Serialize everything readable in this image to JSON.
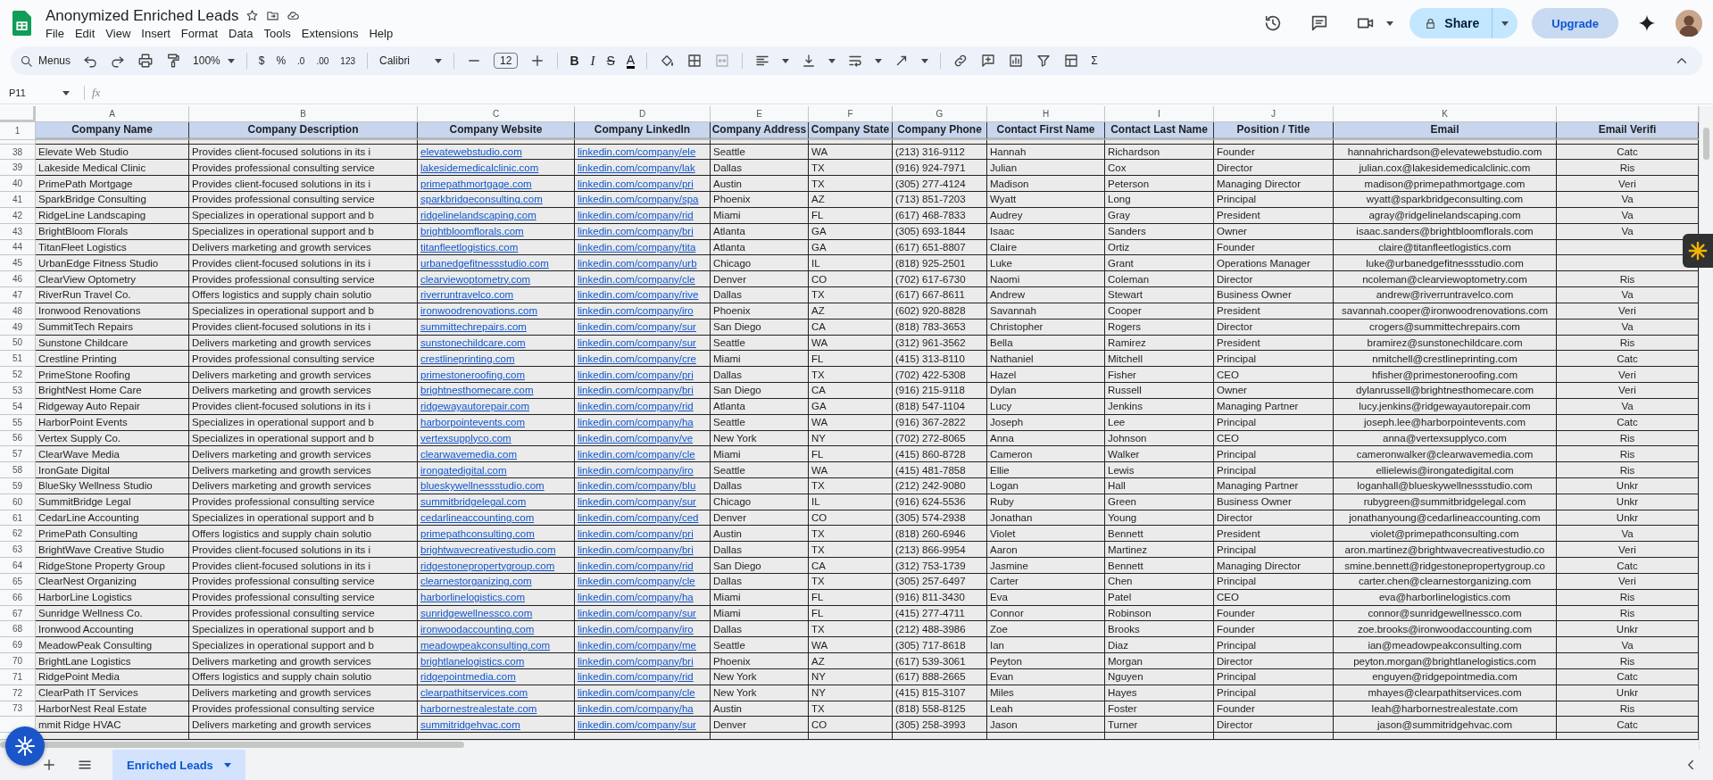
{
  "app": {
    "title": "Anonymized Enriched Leads",
    "menu": [
      "File",
      "Edit",
      "View",
      "Insert",
      "Format",
      "Data",
      "Tools",
      "Extensions",
      "Help"
    ],
    "share": "Share",
    "upgrade": "Upgrade"
  },
  "toolbar": {
    "menus": "Menus",
    "zoom": "100%",
    "currency": "$",
    "percent": "%",
    "decimal_decrease": ".0",
    "decimal_increase": ".00",
    "number_format": "123",
    "font": "Calibri",
    "font_size": "12",
    "bold": "B",
    "italic": "I",
    "strikethrough": "S",
    "text_color": "A",
    "functions": "Σ"
  },
  "formula_bar": {
    "name_box": "P11",
    "label": "fx"
  },
  "sheet": {
    "column_letters": [
      "A",
      "B",
      "C",
      "D",
      "E",
      "F",
      "G",
      "H",
      "I",
      "J",
      "K"
    ],
    "header_row_number": "1",
    "columns": [
      {
        "title": "Company Name",
        "kind": "text"
      },
      {
        "title": "Company Description",
        "kind": "text"
      },
      {
        "title": "Company Website",
        "kind": "link"
      },
      {
        "title": "Company LinkedIn",
        "kind": "link"
      },
      {
        "title": "Company Address",
        "kind": "text"
      },
      {
        "title": "Company State",
        "kind": "text"
      },
      {
        "title": "Company Phone",
        "kind": "text"
      },
      {
        "title": "Contact First Name",
        "kind": "text"
      },
      {
        "title": "Contact Last Name",
        "kind": "text"
      },
      {
        "title": "Position / Title",
        "kind": "text"
      },
      {
        "title": "Email",
        "kind": "center"
      },
      {
        "title": "Email Verifi",
        "kind": "center"
      }
    ],
    "rows": [
      {
        "number": "38",
        "cells": [
          "Elevate Web Studio",
          "Provides client-focused solutions in its i",
          "elevatewebstudio.com",
          "linkedin.com/company/ele",
          "Seattle",
          "WA",
          "(213) 316-9112",
          "Hannah",
          "Richardson",
          "Founder",
          "hannahrichardson@elevatewebstudio.com",
          "Catc"
        ]
      },
      {
        "number": "39",
        "cells": [
          "Lakeside Medical Clinic",
          "Provides professional consulting service",
          "lakesidemedicalclinic.com",
          "linkedin.com/company/lak",
          "Dallas",
          "TX",
          "(916) 924-7971",
          "Julian",
          "Cox",
          "Director",
          "julian.cox@lakesidemedicalclinic.com",
          "Ris"
        ]
      },
      {
        "number": "40",
        "cells": [
          "PrimePath Mortgage",
          "Provides client-focused solutions in its i",
          "primepathmortgage.com",
          "linkedin.com/company/pri",
          "Austin",
          "TX",
          "(305) 277-4124",
          "Madison",
          "Peterson",
          "Managing Director",
          "madison@primepathmortgage.com",
          "Veri"
        ]
      },
      {
        "number": "41",
        "cells": [
          "SparkBridge Consulting",
          "Provides professional consulting service",
          "sparkbridgeconsulting.com",
          "linkedin.com/company/spa",
          "Phoenix",
          "AZ",
          "(713) 851-7203",
          "Wyatt",
          "Long",
          "Principal",
          "wyatt@sparkbridgeconsulting.com",
          "Va"
        ]
      },
      {
        "number": "42",
        "cells": [
          "RidgeLine Landscaping",
          "Specializes in operational support and b",
          "ridgelinelandscaping.com",
          "linkedin.com/company/rid",
          "Miami",
          "FL",
          "(617) 468-7833",
          "Audrey",
          "Gray",
          "President",
          "agray@ridgelinelandscaping.com",
          "Va"
        ]
      },
      {
        "number": "43",
        "cells": [
          "BrightBloom Florals",
          "Specializes in operational support and b",
          "brightbloomflorals.com",
          "linkedin.com/company/bri",
          "Atlanta",
          "GA",
          "(305) 693-1844",
          "Isaac",
          "Sanders",
          "Owner",
          "isaac.sanders@brightbloomflorals.com",
          "Va"
        ]
      },
      {
        "number": "44",
        "cells": [
          "TitanFleet Logistics",
          "Delivers marketing and growth services",
          "titanfleetlogistics.com",
          "linkedin.com/company/tita",
          "Atlanta",
          "GA",
          "(617) 651-8807",
          "Claire",
          "Ortiz",
          "Founder",
          "claire@titanfleetlogistics.com"
        ]
      },
      {
        "number": "45",
        "cells": [
          "UrbanEdge Fitness Studio",
          "Provides client-focused solutions in its i",
          "urbanedgefitnessstudio.com",
          "linkedin.com/company/urb",
          "Chicago",
          "IL",
          "(818) 925-2501",
          "Luke",
          "Grant",
          "Operations Manager",
          "luke@urbanedgefitnessstudio.com"
        ]
      },
      {
        "number": "46",
        "cells": [
          "ClearView Optometry",
          "Provides professional consulting service",
          "clearviewoptometry.com",
          "linkedin.com/company/cle",
          "Denver",
          "CO",
          "(702) 617-6730",
          "Naomi",
          "Coleman",
          "Director",
          "ncoleman@clearviewoptometry.com",
          "Ris"
        ]
      },
      {
        "number": "47",
        "cells": [
          "RiverRun Travel Co.",
          "Offers logistics and supply chain solutio",
          "riverruntravelco.com",
          "linkedin.com/company/rive",
          "Dallas",
          "TX",
          "(617) 667-8611",
          "Andrew",
          "Stewart",
          "Business Owner",
          "andrew@riverruntravelco.com",
          "Va"
        ]
      },
      {
        "number": "48",
        "cells": [
          "Ironwood Renovations",
          "Specializes in operational support and b",
          "ironwoodrenovations.com",
          "linkedin.com/company/iro",
          "Phoenix",
          "AZ",
          "(602) 920-8828",
          "Savannah",
          "Cooper",
          "President",
          "savannah.cooper@ironwoodrenovations.com",
          "Veri"
        ]
      },
      {
        "number": "49",
        "cells": [
          "SummitTech Repairs",
          "Provides client-focused solutions in its i",
          "summittechrepairs.com",
          "linkedin.com/company/sur",
          "San Diego",
          "CA",
          "(818) 783-3653",
          "Christopher",
          "Rogers",
          "Director",
          "crogers@summittechrepairs.com",
          "Va"
        ]
      },
      {
        "number": "50",
        "cells": [
          "Sunstone Childcare",
          "Delivers marketing and growth services",
          "sunstonechildcare.com",
          "linkedin.com/company/sur",
          "Seattle",
          "WA",
          "(312) 961-3562",
          "Bella",
          "Ramirez",
          "President",
          "bramirez@sunstonechildcare.com",
          "Ris"
        ]
      },
      {
        "number": "51",
        "cells": [
          "Crestline Printing",
          "Provides professional consulting service",
          "crestlineprinting.com",
          "linkedin.com/company/cre",
          "Miami",
          "FL",
          "(415) 313-8110",
          "Nathaniel",
          "Mitchell",
          "Principal",
          "nmitchell@crestlineprinting.com",
          "Catc"
        ]
      },
      {
        "number": "52",
        "cells": [
          "PrimeStone Roofing",
          "Delivers marketing and growth services",
          "primestoneroofing.com",
          "linkedin.com/company/pri",
          "Dallas",
          "TX",
          "(702) 422-5308",
          "Hazel",
          "Fisher",
          "CEO",
          "hfisher@primestoneroofing.com",
          "Veri"
        ]
      },
      {
        "number": "53",
        "cells": [
          "BrightNest Home Care",
          "Delivers marketing and growth services",
          "brightnesthomecare.com",
          "linkedin.com/company/bri",
          "San Diego",
          "CA",
          "(916) 215-9118",
          "Dylan",
          "Russell",
          "Owner",
          "dylanrussell@brightnesthomecare.com",
          "Veri"
        ]
      },
      {
        "number": "54",
        "cells": [
          "Ridgeway Auto Repair",
          "Provides client-focused solutions in its i",
          "ridgewayautorepair.com",
          "linkedin.com/company/rid",
          "Atlanta",
          "GA",
          "(818) 547-1104",
          "Lucy",
          "Jenkins",
          "Managing Partner",
          "lucy.jenkins@ridgewayautorepair.com",
          "Va"
        ]
      },
      {
        "number": "55",
        "cells": [
          "HarborPoint Events",
          "Specializes in operational support and b",
          "harborpointevents.com",
          "linkedin.com/company/ha",
          "Seattle",
          "WA",
          "(916) 367-2822",
          "Joseph",
          "Lee",
          "Principal",
          "joseph.lee@harborpointevents.com",
          "Catc"
        ]
      },
      {
        "number": "56",
        "cells": [
          "Vertex Supply Co.",
          "Specializes in operational support and b",
          "vertexsupplyco.com",
          "linkedin.com/company/ve",
          "New York",
          "NY",
          "(702) 272-8065",
          "Anna",
          "Johnson",
          "CEO",
          "anna@vertexsupplyco.com",
          "Ris"
        ]
      },
      {
        "number": "57",
        "cells": [
          "ClearWave Media",
          "Delivers marketing and growth services",
          "clearwavemedia.com",
          "linkedin.com/company/cle",
          "Miami",
          "FL",
          "(415) 860-8728",
          "Cameron",
          "Walker",
          "Principal",
          "cameronwalker@clearwavemedia.com",
          "Ris"
        ]
      },
      {
        "number": "58",
        "cells": [
          "IronGate Digital",
          "Delivers marketing and growth services",
          "irongatedigital.com",
          "linkedin.com/company/iro",
          "Seattle",
          "WA",
          "(415) 481-7858",
          "Ellie",
          "Lewis",
          "Principal",
          "ellielewis@irongatedigital.com",
          "Ris"
        ]
      },
      {
        "number": "59",
        "cells": [
          "BlueSky Wellness Studio",
          "Delivers marketing and growth services",
          "blueskywellnessstudio.com",
          "linkedin.com/company/blu",
          "Dallas",
          "TX",
          "(212) 242-9080",
          "Logan",
          "Hall",
          "Managing Partner",
          "loganhall@blueskywellnessstudio.com",
          "Unkr"
        ]
      },
      {
        "number": "60",
        "cells": [
          "SummitBridge Legal",
          "Provides professional consulting service",
          "summitbridgelegal.com",
          "linkedin.com/company/sur",
          "Chicago",
          "IL",
          "(916) 624-5536",
          "Ruby",
          "Green",
          "Business Owner",
          "rubygreen@summitbridgelegal.com",
          "Unkr"
        ]
      },
      {
        "number": "61",
        "cells": [
          "CedarLine Accounting",
          "Specializes in operational support and b",
          "cedarlineaccounting.com",
          "linkedin.com/company/ced",
          "Denver",
          "CO",
          "(305) 574-2938",
          "Jonathan",
          "Young",
          "Director",
          "jonathanyoung@cedarlineaccounting.com",
          "Unkr"
        ]
      },
      {
        "number": "62",
        "cells": [
          "PrimePath Consulting",
          "Offers logistics and supply chain solutio",
          "primepathconsulting.com",
          "linkedin.com/company/pri",
          "Austin",
          "TX",
          "(818) 260-6946",
          "Violet",
          "Bennett",
          "President",
          "violet@primepathconsulting.com",
          "Va"
        ]
      },
      {
        "number": "63",
        "cells": [
          "BrightWave Creative Studio",
          "Provides client-focused solutions in its i",
          "brightwavecreativestudio.com",
          "linkedin.com/company/bri",
          "Dallas",
          "TX",
          "(213) 866-9954",
          "Aaron",
          "Martinez",
          "Principal",
          "aron.martinez@brightwavecreativestudio.co",
          "Veri"
        ]
      },
      {
        "number": "64",
        "cells": [
          "RidgeStone Property Group",
          "Provides client-focused solutions in its i",
          "ridgestonepropertygroup.com",
          "linkedin.com/company/rid",
          "San Diego",
          "CA",
          "(312) 753-1739",
          "Jasmine",
          "Bennett",
          "Managing Director",
          "smine.bennett@ridgestonepropertygroup.co",
          "Catc"
        ]
      },
      {
        "number": "65",
        "cells": [
          "ClearNest Organizing",
          "Provides professional consulting service",
          "clearnestorganizing.com",
          "linkedin.com/company/cle",
          "Dallas",
          "TX",
          "(305) 257-6497",
          "Carter",
          "Chen",
          "Principal",
          "carter.chen@clearnestorganizing.com",
          "Veri"
        ]
      },
      {
        "number": "66",
        "cells": [
          "HarborLine Logistics",
          "Provides professional consulting service",
          "harborlinelogistics.com",
          "linkedin.com/company/ha",
          "Miami",
          "FL",
          "(916) 811-3430",
          "Eva",
          "Patel",
          "CEO",
          "eva@harborlinelogistics.com",
          "Ris"
        ]
      },
      {
        "number": "67",
        "cells": [
          "Sunridge Wellness Co.",
          "Provides professional consulting service",
          "sunridgewellnessco.com",
          "linkedin.com/company/sur",
          "Miami",
          "FL",
          "(415) 277-4711",
          "Connor",
          "Robinson",
          "Founder",
          "connor@sunridgewellnessco.com",
          "Ris"
        ]
      },
      {
        "number": "68",
        "cells": [
          "Ironwood Accounting",
          "Specializes in operational support and b",
          "ironwoodaccounting.com",
          "linkedin.com/company/iro",
          "Dallas",
          "TX",
          "(212) 488-3986",
          "Zoe",
          "Brooks",
          "Founder",
          "zoe.brooks@ironwoodaccounting.com",
          "Unkr"
        ]
      },
      {
        "number": "69",
        "cells": [
          "MeadowPeak Consulting",
          "Specializes in operational support and b",
          "meadowpeakconsulting.com",
          "linkedin.com/company/me",
          "Seattle",
          "WA",
          "(305) 717-8618",
          "Ian",
          "Diaz",
          "Principal",
          "ian@meadowpeakconsulting.com",
          "Va"
        ]
      },
      {
        "number": "70",
        "cells": [
          "BrightLane Logistics",
          "Delivers marketing and growth services",
          "brightlanelogistics.com",
          "linkedin.com/company/bri",
          "Phoenix",
          "AZ",
          "(617) 539-3061",
          "Peyton",
          "Morgan",
          "Director",
          "peyton.morgan@brightlanelogistics.com",
          "Ris"
        ]
      },
      {
        "number": "71",
        "cells": [
          "RidgePoint Media",
          "Offers logistics and supply chain solutio",
          "ridgepointmedia.com",
          "linkedin.com/company/rid",
          "New York",
          "NY",
          "(617) 888-2665",
          "Evan",
          "Nguyen",
          "Principal",
          "enguyen@ridgepointmedia.com",
          "Catc"
        ]
      },
      {
        "number": "72",
        "cells": [
          "ClearPath IT Services",
          "Delivers marketing and growth services",
          "clearpathitservices.com",
          "linkedin.com/company/cle",
          "New York",
          "NY",
          "(415) 815-3107",
          "Miles",
          "Hayes",
          "Principal",
          "mhayes@clearpathitservices.com",
          "Unkr"
        ]
      },
      {
        "number": "73",
        "cells": [
          "HarborNest Real Estate",
          "Provides professional consulting service",
          "harbornestrealestate.com",
          "linkedin.com/company/ha",
          "Austin",
          "TX",
          "(818) 558-8125",
          "Leah",
          "Foster",
          "Founder",
          "leah@harbornestrealestate.com",
          "Ris"
        ]
      },
      {
        "cells": [
          "mmit Ridge HVAC",
          "Delivers marketing and growth services",
          "summitridgehvac.com",
          "linkedin.com/company/sur",
          "Denver",
          "CO",
          "(305) 258-3993",
          "Jason",
          "Turner",
          "Director",
          "jason@summitridgehvac.com",
          "Catc"
        ]
      }
    ]
  },
  "sheet_tabs": [
    {
      "label": "Enriched Leads",
      "selected": true
    }
  ]
}
